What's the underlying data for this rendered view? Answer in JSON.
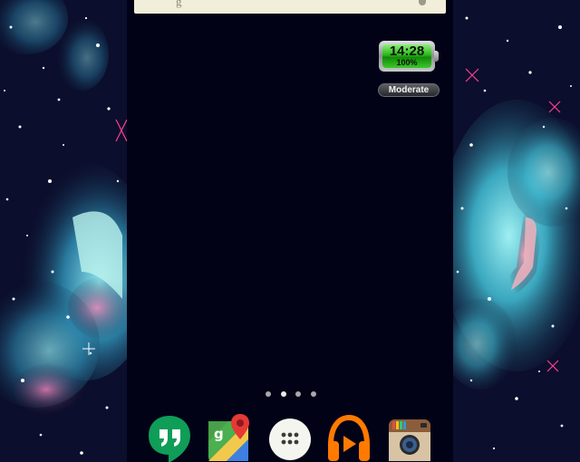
{
  "wallpaper": {
    "name": "galaxy-nebula-wallpaper",
    "colors": {
      "space": "#0a0d28",
      "nebula_cyan": "#3fb8cf",
      "nebula_pink": "#e06c9f",
      "stars": "#ffffff"
    }
  },
  "search_bar": {
    "partial_text": "g",
    "icon": "mic-icon",
    "background": "#f1eed9"
  },
  "battery_widget": {
    "time": "14:28",
    "percent": "100%",
    "level": 1.0,
    "fill_color": "#2bb81b"
  },
  "mode_button": {
    "label": "Moderate"
  },
  "page_indicator": {
    "pages": 4,
    "active_index": 1
  },
  "dock": {
    "apps": [
      {
        "name": "hangouts-app-icon",
        "color": "#0f9d58"
      },
      {
        "name": "google-maps-app-icon",
        "color": "#4caf50"
      },
      {
        "name": "app-drawer-icon",
        "color": "#f5f5f0"
      },
      {
        "name": "google-play-music-app-icon",
        "color": "#ff7a00"
      },
      {
        "name": "instagram-app-icon",
        "color": "#a47a5b"
      }
    ]
  },
  "colors": {
    "home_background": "#020217",
    "pill_text": "#f2f2f2"
  }
}
